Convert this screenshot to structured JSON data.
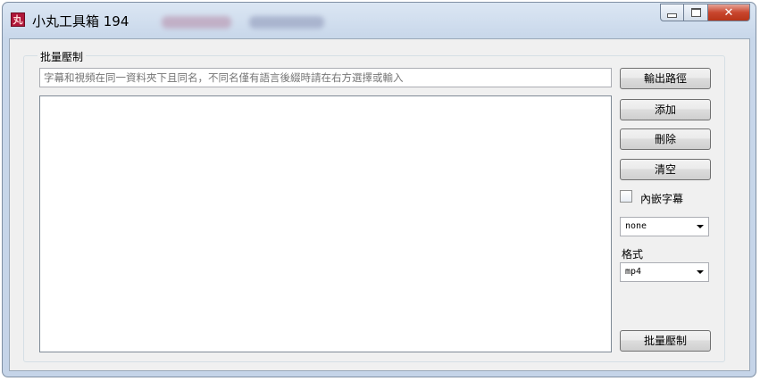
{
  "window": {
    "title": "小丸工具箱 194",
    "icon_glyph": "丸",
    "icon_color": "#b0173a",
    "controls": {
      "minimize": "minimize-icon",
      "maximize": "maximize-icon",
      "close_glyph": "✕"
    }
  },
  "group": {
    "label": "批量壓制"
  },
  "hint_input": {
    "placeholder": "字幕和視頻在同一資料夾下且同名，不同名僅有語言後綴時請在右方選擇或輸入"
  },
  "buttons": {
    "output_path": "輸出路徑",
    "add": "添加",
    "delete": "刪除",
    "clear": "清空",
    "batch_encode": "批量壓制"
  },
  "embed_subtitle": {
    "label": "內嵌字幕",
    "checked": false
  },
  "subtitle_suffix": {
    "selected": "none",
    "options": [
      "none"
    ]
  },
  "format": {
    "label": "格式",
    "selected": "mp4",
    "options": [
      "mp4"
    ]
  }
}
